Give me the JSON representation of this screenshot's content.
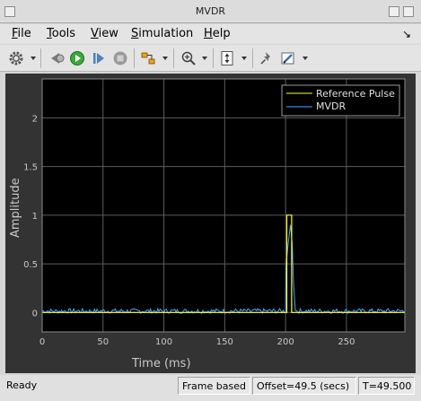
{
  "window": {
    "title": "MVDR"
  },
  "menu": [
    {
      "label": "File",
      "mnemonic": "F",
      "rest": "ile"
    },
    {
      "label": "Tools",
      "mnemonic": "T",
      "rest": "ools"
    },
    {
      "label": "View",
      "mnemonic": "V",
      "rest": "iew"
    },
    {
      "label": "Simulation",
      "mnemonic": "S",
      "rest": "imulation"
    },
    {
      "label": "Help",
      "mnemonic": "H",
      "rest": "elp"
    }
  ],
  "toolbar_icons": [
    "settings-icon",
    "step-back-icon",
    "run-icon",
    "step-forward-icon",
    "stop-icon",
    "highlight-signal-icon",
    "zoom-in-icon",
    "scale-axes-icon",
    "pin-icon",
    "style-icon"
  ],
  "status": {
    "ready": "Ready",
    "mode": "Frame based",
    "offset": "Offset=49.5 (secs)",
    "time": "T=49.500"
  },
  "chart_data": {
    "type": "line",
    "xlabel": "Time (ms)",
    "ylabel": "Amplitude",
    "xlim": [
      0,
      298
    ],
    "ylim": [
      -0.2,
      2.4
    ],
    "xticks": [
      0,
      50,
      100,
      150,
      200,
      250
    ],
    "yticks": [
      0,
      0.5,
      1,
      1.5,
      2
    ],
    "ytick_labels": [
      "0",
      "0.5",
      "1",
      "1.5",
      "2"
    ],
    "grid": true,
    "legend_position": "top-right",
    "colors": {
      "background": "#000000",
      "frame": "#333333",
      "grid": "#5c5c5c",
      "axis_text": "#c8c8c8"
    },
    "series": [
      {
        "name": "Reference Pulse",
        "color": "#ffff33",
        "x": [
          0,
          201,
          201,
          205,
          205,
          298
        ],
        "y": [
          0,
          0,
          1,
          1,
          0,
          0
        ]
      },
      {
        "name": "MVDR",
        "color": "#4da6ff",
        "noise_level": 0.03,
        "pulse_x": [
          200.5,
          202,
          204,
          205.5,
          206.5,
          208
        ],
        "pulse_y": [
          0.5,
          0.7,
          0.9,
          0.7,
          0.3,
          0.02
        ]
      }
    ]
  }
}
